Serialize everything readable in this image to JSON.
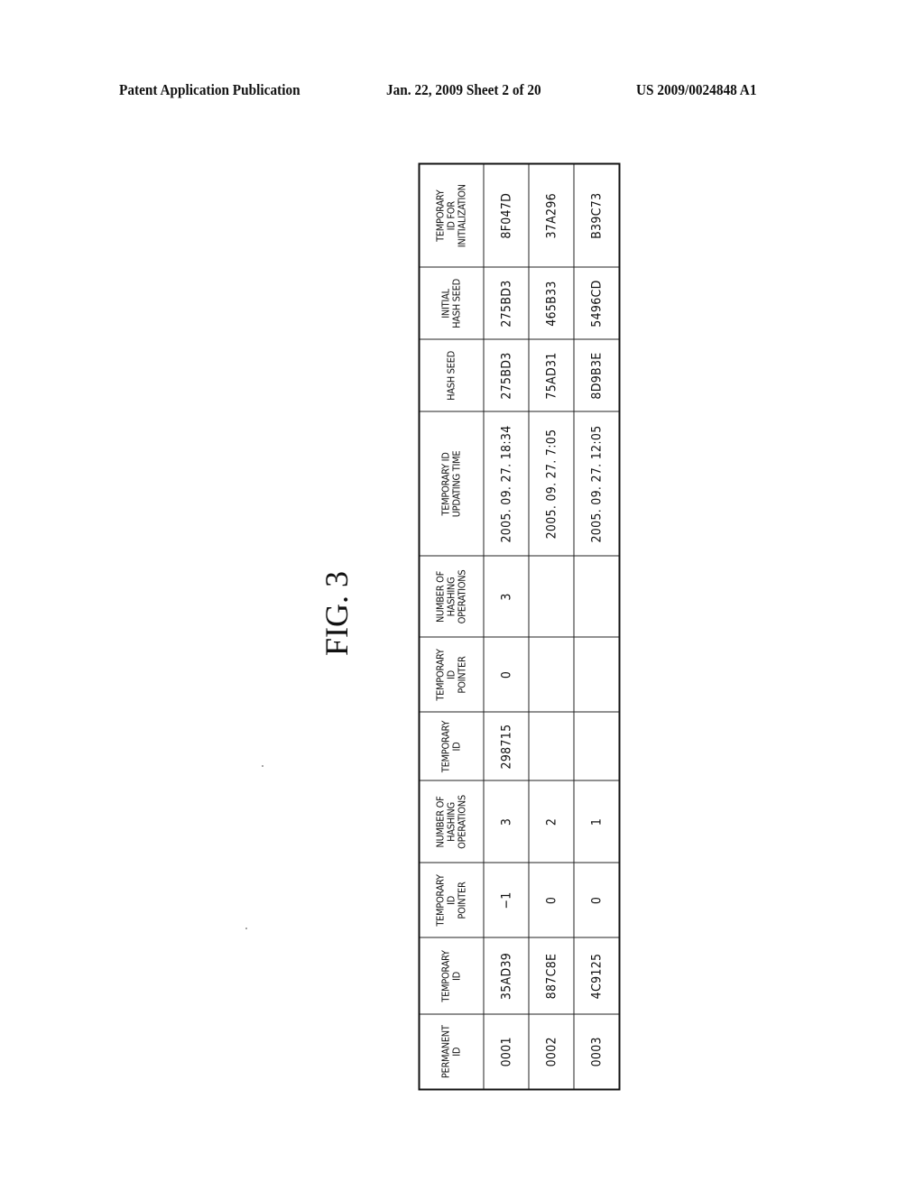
{
  "header": {
    "left": "Patent Application Publication",
    "middle": "Jan. 22, 2009  Sheet 2 of 20",
    "right": "US 2009/0024848 A1"
  },
  "figure": {
    "title": "FIG. 3"
  },
  "table": {
    "columns": [
      [
        "PERMANENT",
        "ID"
      ],
      [
        "TEMPORARY",
        "ID"
      ],
      [
        "TEMPORARY",
        "ID",
        "POINTER"
      ],
      [
        "NUMBER OF",
        "HASHING",
        "OPERATIONS"
      ],
      [
        "TEMPORARY",
        "ID"
      ],
      [
        "TEMPORARY",
        "ID",
        "POINTER"
      ],
      [
        "NUMBER OF",
        "HASHING",
        "OPERATIONS"
      ],
      [
        "TEMPORARY ID",
        "UPDATING TIME"
      ],
      [
        "HASH SEED"
      ],
      [
        "INITIAL",
        "HASH SEED"
      ],
      [
        "TEMPORARY",
        "ID FOR",
        "INITIALIZATION"
      ]
    ],
    "rows": [
      [
        "0001",
        "35AD39",
        "−1",
        "3",
        "298715",
        "0",
        "3",
        "2005. 09. 27. 18:34",
        "275BD3",
        "275BD3",
        "8F047D"
      ],
      [
        "0002",
        "887C8E",
        "0",
        "2",
        "",
        "",
        "",
        "2005. 09. 27. 7:05",
        "75AD31",
        "465B33",
        "37A296"
      ],
      [
        "0003",
        "4C9125",
        "0",
        "1",
        "",
        "",
        "",
        "2005. 09. 27. 12:05",
        "8D9B3E",
        "5496CD",
        "B39C73"
      ]
    ]
  }
}
